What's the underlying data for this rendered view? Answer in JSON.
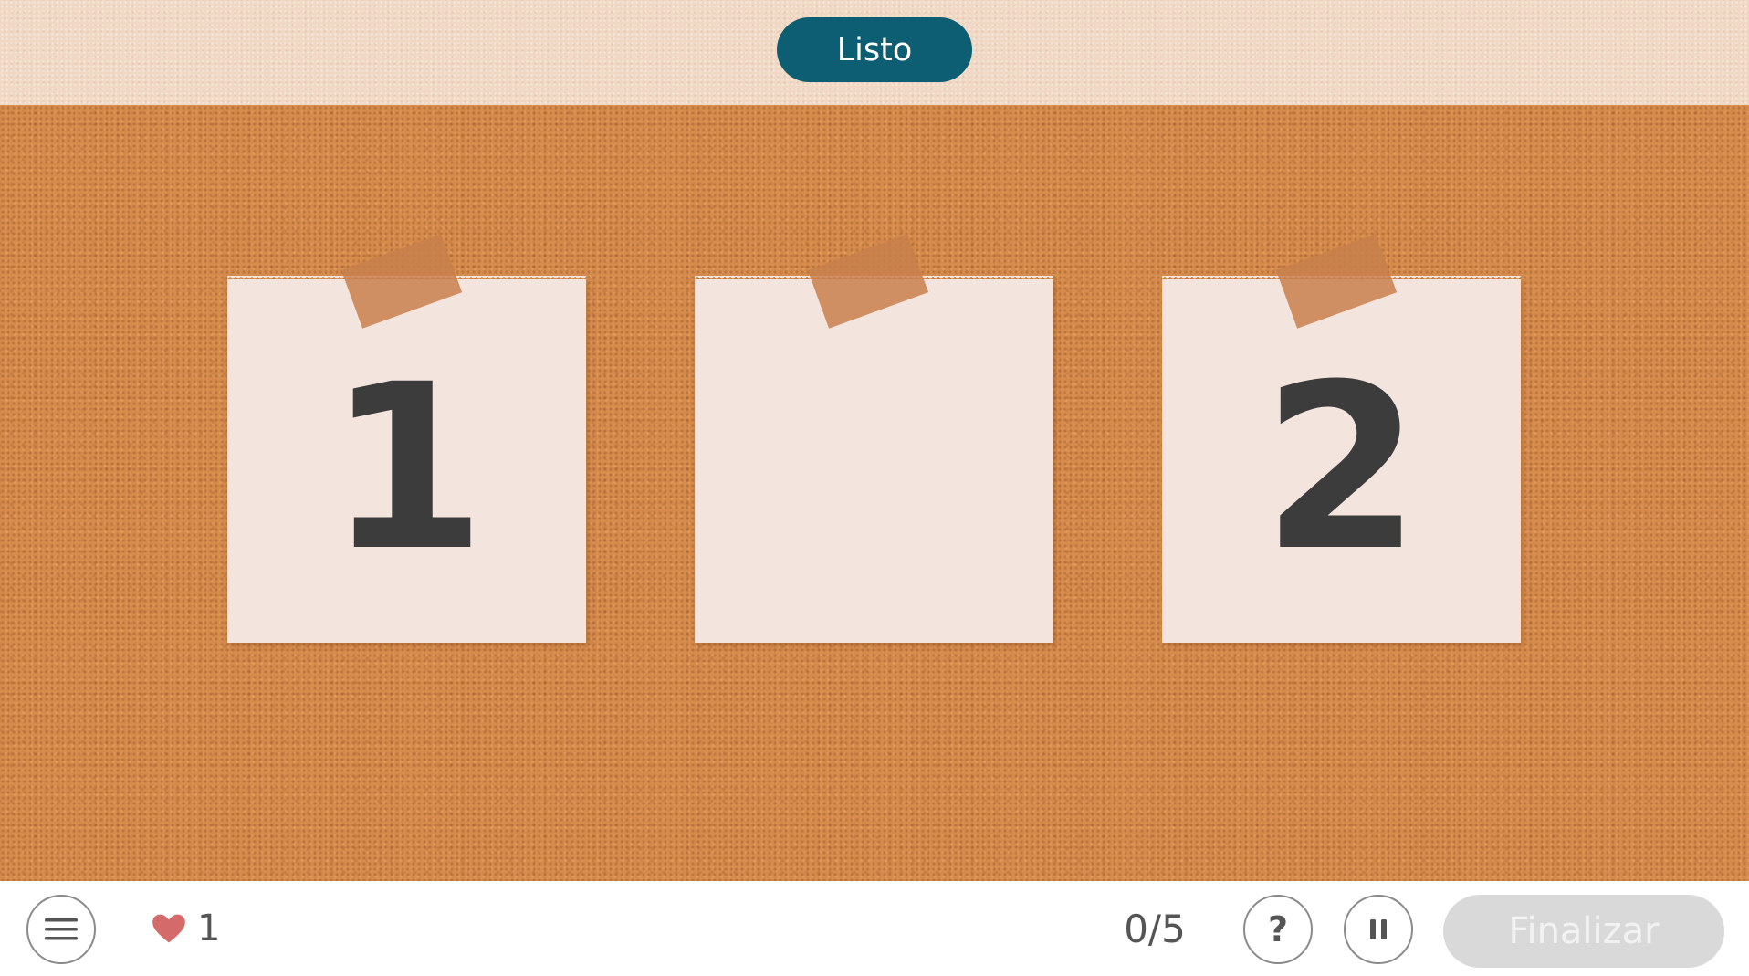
{
  "header": {
    "listo_label": "Listo"
  },
  "board": {
    "notes": [
      {
        "value": "1"
      },
      {
        "value": ""
      },
      {
        "value": "2"
      }
    ]
  },
  "footer": {
    "menu_icon": "hamburger-menu-icon",
    "lives_icon": "heart-icon",
    "lives_count": "1",
    "progress": "0/5",
    "help_label": "?",
    "pause_icon": "pause-icon",
    "finish_label": "Finalizar"
  },
  "colors": {
    "accent": "#0d5d73",
    "cork": "#d4894a",
    "note": "#f4e4de",
    "heart": "#d46a6a",
    "disabled": "#d9d9d9"
  }
}
